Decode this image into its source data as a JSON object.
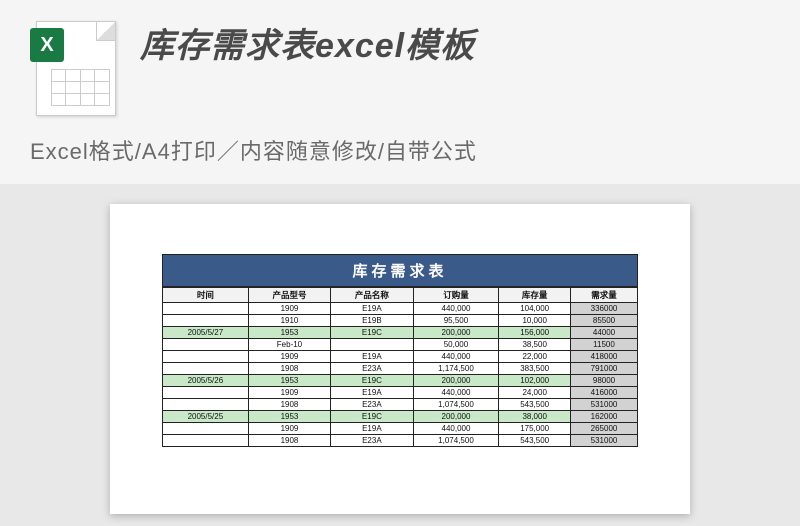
{
  "header": {
    "title": "库存需求表excel模板",
    "subtitle": "Excel格式/A4打印／内容随意修改/自带公式",
    "icon": "excel-file-icon"
  },
  "sheet": {
    "title": "库存需求表",
    "columns": [
      "时间",
      "产品型号",
      "产品名称",
      "订购量",
      "库存量",
      "需求量"
    ],
    "rows": [
      {
        "hl": false,
        "cells": [
          "",
          "1909",
          "E19A",
          "440,000",
          "104,000",
          "336000"
        ]
      },
      {
        "hl": false,
        "cells": [
          "",
          "1910",
          "E19B",
          "95,500",
          "10,000",
          "85500"
        ]
      },
      {
        "hl": true,
        "cells": [
          "2005/5/27",
          "1953",
          "E19C",
          "200,000",
          "156,000",
          "44000"
        ]
      },
      {
        "hl": false,
        "cells": [
          "",
          "Feb-10",
          "",
          "50,000",
          "38,500",
          "11500"
        ]
      },
      {
        "hl": false,
        "cells": [
          "",
          "1909",
          "E19A",
          "440,000",
          "22,000",
          "418000"
        ]
      },
      {
        "hl": false,
        "cells": [
          "",
          "1908",
          "E23A",
          "1,174,500",
          "383,500",
          "791000"
        ]
      },
      {
        "hl": true,
        "cells": [
          "2005/5/26",
          "1953",
          "E19C",
          "200,000",
          "102,000",
          "98000"
        ]
      },
      {
        "hl": false,
        "cells": [
          "",
          "1909",
          "E19A",
          "440,000",
          "24,000",
          "416000"
        ]
      },
      {
        "hl": false,
        "cells": [
          "",
          "1908",
          "E23A",
          "1,074,500",
          "543,500",
          "531000"
        ]
      },
      {
        "hl": true,
        "cells": [
          "2005/5/25",
          "1953",
          "E19C",
          "200,000",
          "38,000",
          "162000"
        ]
      },
      {
        "hl": false,
        "cells": [
          "",
          "1909",
          "E19A",
          "440,000",
          "175,000",
          "265000"
        ]
      },
      {
        "hl": false,
        "cells": [
          "",
          "1908",
          "E23A",
          "1,074,500",
          "543,500",
          "531000"
        ]
      }
    ]
  }
}
